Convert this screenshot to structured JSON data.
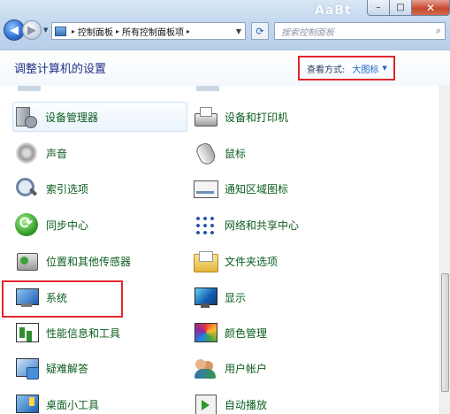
{
  "window": {
    "brand": "AaBt",
    "caption": {
      "minimize_glyph": "–",
      "maximize_glyph": "□",
      "close_glyph": "✕"
    }
  },
  "nav": {
    "back_glyph": "◀",
    "forward_glyph": "▶",
    "dropdown_glyph": "▼"
  },
  "address": {
    "crumbs": [
      "控制面板",
      "所有控制面板项"
    ],
    "separator": "▸",
    "dropdown_glyph": "▼",
    "refresh_glyph": "⟳"
  },
  "search": {
    "placeholder": "搜索控制面板",
    "icon": "search-icon",
    "icon_glyph": "⌕"
  },
  "header": {
    "title": "调整计算机的设置",
    "view_by_label": "查看方式:",
    "view_by_value": "大图标",
    "view_by_caret": "▼"
  },
  "items": [
    {
      "label": "设备管理器",
      "icon": "device-manager-icon"
    },
    {
      "label": "设备和打印机",
      "icon": "devices-printers-icon"
    },
    {
      "label": "声音",
      "icon": "sound-icon"
    },
    {
      "label": "鼠标",
      "icon": "mouse-icon"
    },
    {
      "label": "索引选项",
      "icon": "indexing-options-icon"
    },
    {
      "label": "通知区域图标",
      "icon": "notification-area-icon"
    },
    {
      "label": "同步中心",
      "icon": "sync-center-icon"
    },
    {
      "label": "网络和共享中心",
      "icon": "network-sharing-icon"
    },
    {
      "label": "位置和其他传感器",
      "icon": "location-sensors-icon"
    },
    {
      "label": "文件夹选项",
      "icon": "folder-options-icon"
    },
    {
      "label": "系统",
      "icon": "system-icon"
    },
    {
      "label": "显示",
      "icon": "display-icon"
    },
    {
      "label": "性能信息和工具",
      "icon": "performance-icon"
    },
    {
      "label": "颜色管理",
      "icon": "color-management-icon"
    },
    {
      "label": "疑难解答",
      "icon": "troubleshooting-icon"
    },
    {
      "label": "用户帐户",
      "icon": "user-accounts-icon"
    },
    {
      "label": "桌面小工具",
      "icon": "desktop-gadgets-icon"
    },
    {
      "label": "自动播放",
      "icon": "autoplay-icon"
    }
  ],
  "colors": {
    "link_green": "#0b5d1e",
    "title_blue": "#1e3287",
    "highlight_red": "#e0262c"
  }
}
